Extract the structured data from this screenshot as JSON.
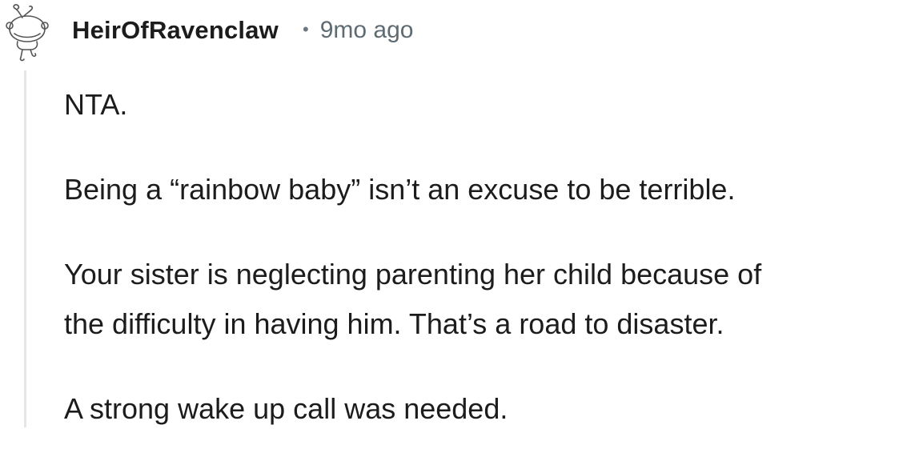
{
  "comment": {
    "username": "HeirOfRavenclaw",
    "separator": "•",
    "timestamp": "9mo ago",
    "avatar_icon": "snoo-avatar-icon",
    "paragraphs": {
      "p1": "NTA.",
      "p2": "Being a “rainbow baby” isn’t an excuse to be terrible.",
      "p3_line1": "Your sister is neglecting parenting her child because of",
      "p3_line2": "the difficulty in having him. That’s a road to disaster.",
      "p4": "A strong wake up call was needed."
    }
  },
  "colors": {
    "text": "#1c1c1c",
    "meta": "#5e6b73",
    "thread_line": "#e5e5e5"
  }
}
